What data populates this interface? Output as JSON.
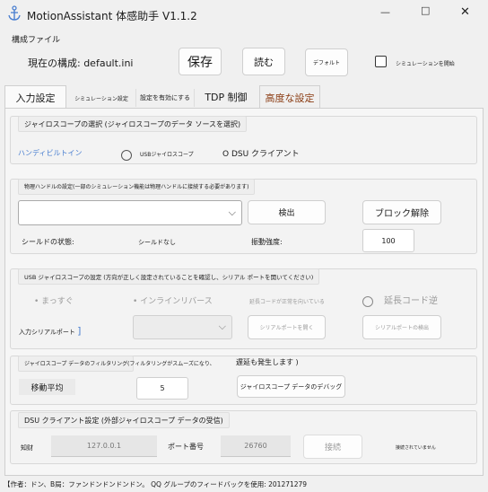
{
  "window": {
    "title": "MotionAssistant 体感助手 V1.1.2",
    "controls": {
      "minimize": "—",
      "maximize": "□",
      "close": "✕"
    }
  },
  "config": {
    "section_title": "構成ファイル",
    "current_label": "現在の構成: default.ini",
    "save_label": "保存",
    "read_label": "読む",
    "default_label": "デフォルト",
    "simulation_label": "シミュレーションを開始"
  },
  "tabs": [
    {
      "label": "入力設定",
      "active": true
    },
    {
      "label": "シミュレーション設定"
    },
    {
      "label": "設定を有効にする"
    },
    {
      "label": "TDP 制御"
    },
    {
      "label": "高度な設定",
      "color": "#8a3b12"
    }
  ],
  "gyro_select": {
    "title": "ジャイロスコープの選択 (ジャイロスコープのデータ ソースを選択)",
    "options": [
      "ハンディビルトイン",
      "USBジャイロスコープ",
      "O DSU クライアント"
    ]
  },
  "physical": {
    "title": "物理ハンドルの設定(一部のシミュレーション機能は物理ハンドルに接続する必要があります)",
    "detect_label": "検出",
    "unblock_label": "ブロック解除",
    "shield_label": "シールドの状態:",
    "shield_value": "シールドなし",
    "vibration_label": "振動強度:",
    "vibration_value": "100"
  },
  "usb_gyro": {
    "title": "USB ジャイロスコープの設定 (方向が正しく設定されていることを確認し、シリアル ポートを開いてください)",
    "opt_straight": "まっすぐ",
    "opt_inline_reverse": "インラインリバース",
    "ext_note": "延長コードが正常を向いている",
    "ext_reverse": "延長コード逆",
    "serial_label": "入力シリアルポート",
    "open_port": "シリアルポートを開く",
    "detect_port": "シリアルポートの検出"
  },
  "filter": {
    "title": "ジャイロスコープ データのフィルタリング",
    "note": "(フィルタリングがスムーズになり、",
    "delay": "遅延も発生します )",
    "moving_avg_label": "移動平均",
    "moving_avg_value": "5",
    "debug_label": "ジャイロスコープ データのデバッグ"
  },
  "dsu": {
    "title": "DSU クライアント設定 (外部ジャイロスコープ データの受信)",
    "addr_label": "知财",
    "addr_value": "127.0.0.1",
    "port_label": "ポート番号",
    "port_value": "26760",
    "connect_label": "接続",
    "status": "接続されていません"
  },
  "footer": {
    "text": "【作者：ドン、B局：ファンドンドンドンドン。 QQ グループのフィードバックを使用: 201271279"
  },
  "colors": {
    "accent": "#4a7fd0",
    "advanced_tab": "#8a3b12"
  }
}
